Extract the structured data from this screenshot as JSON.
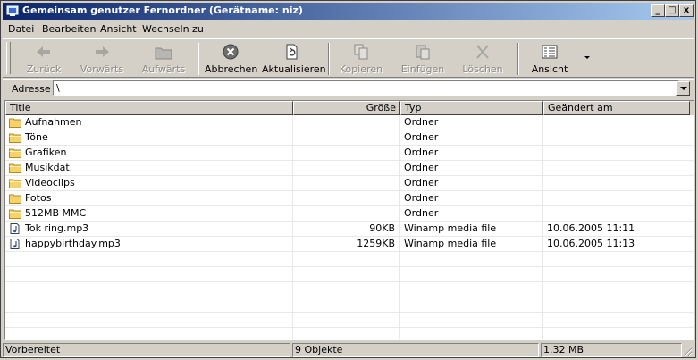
{
  "window": {
    "title": "Gemeinsam genutzer Fernordner (Gerätname: niz)",
    "controls": {
      "minimize": "_",
      "maximize": "□",
      "close": "x"
    }
  },
  "menu": [
    "Datei",
    "Bearbeiten",
    "Ansicht",
    "Wechseln zu"
  ],
  "toolbar": {
    "back": "Zurück",
    "forward": "Vorwärts",
    "up": "Aufwärts",
    "stop": "Abbrechen",
    "refresh": "Aktualisieren",
    "copy": "Kopieren",
    "paste": "Einfügen",
    "delete": "Löschen",
    "view": "Ansicht"
  },
  "address": {
    "label": "Adresse",
    "value": "\\"
  },
  "columns": {
    "title": "Title",
    "size": "Größe",
    "type": "Typ",
    "modified": "Geändert am"
  },
  "files": [
    {
      "name": "Aufnahmen",
      "size": "",
      "type": "Ordner",
      "modified": "",
      "icon": "folder-icon"
    },
    {
      "name": "Töne",
      "size": "",
      "type": "Ordner",
      "modified": "",
      "icon": "folder-icon"
    },
    {
      "name": "Grafiken",
      "size": "",
      "type": "Ordner",
      "modified": "",
      "icon": "folder-icon"
    },
    {
      "name": "Musikdat.",
      "size": "",
      "type": "Ordner",
      "modified": "",
      "icon": "folder-icon"
    },
    {
      "name": "Videoclips",
      "size": "",
      "type": "Ordner",
      "modified": "",
      "icon": "folder-icon"
    },
    {
      "name": "Fotos",
      "size": "",
      "type": "Ordner",
      "modified": "",
      "icon": "folder-icon"
    },
    {
      "name": "512MB MMC",
      "size": "",
      "type": "Ordner",
      "modified": "",
      "icon": "folder-icon"
    },
    {
      "name": "Tok ring.mp3",
      "size": "90KB",
      "type": "Winamp media file",
      "modified": "10.06.2005 11:11",
      "icon": "audio-file-icon"
    },
    {
      "name": "happybirthday.mp3",
      "size": "1259KB",
      "type": "Winamp media file",
      "modified": "10.06.2005 11:13",
      "icon": "audio-file-icon"
    }
  ],
  "status": {
    "ready": "Vorbereitet",
    "count": "9 Objekte",
    "size": "1.32 MB"
  },
  "colors": {
    "title_start": "#0a246a",
    "title_end": "#a6caf0",
    "chrome": "#d4d0c8",
    "folder": "#f6d36a"
  }
}
